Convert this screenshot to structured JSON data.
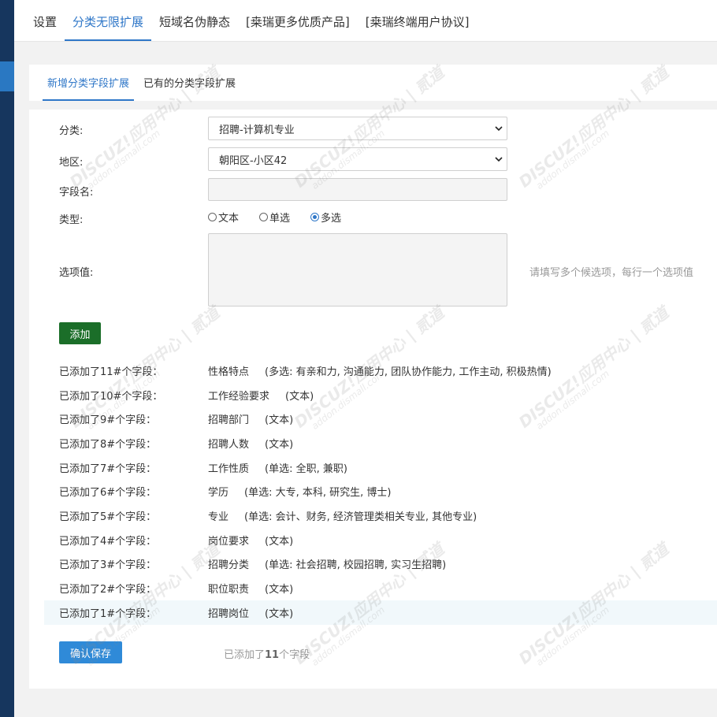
{
  "top_nav": {
    "tabs": [
      {
        "label": "设置"
      },
      {
        "label": "分类无限扩展"
      },
      {
        "label": "短域名伪静态"
      },
      {
        "label": "[桒瑞更多优质产品]"
      },
      {
        "label": "[桒瑞终端用户协议]"
      }
    ],
    "active_index": 1
  },
  "sub_tabs": {
    "tabs": [
      {
        "label": "新增分类字段扩展"
      },
      {
        "label": "已有的分类字段扩展"
      }
    ],
    "active_index": 0
  },
  "form": {
    "category_label": "分类:",
    "category_value": "招聘-计算机专业",
    "region_label": "地区:",
    "region_value": "朝阳区-小区42",
    "field_name_label": "字段名:",
    "field_name_value": "",
    "type_label": "类型:",
    "type_options": [
      "文本",
      "单选",
      "多选"
    ],
    "type_selected": "多选",
    "options_label": "选项值:",
    "options_hint": "请填写多个候选项，每行一个选项值",
    "add_button": "添加"
  },
  "added_fields": [
    {
      "label": "已添加了11#个字段：",
      "name": "性格特点",
      "type": "(多选: 有亲和力, 沟通能力, 团队协作能力, 工作主动, 积极热情)"
    },
    {
      "label": "已添加了10#个字段：",
      "name": "工作经验要求",
      "type": "(文本)"
    },
    {
      "label": "已添加了9#个字段：",
      "name": "招聘部门",
      "type": "(文本)"
    },
    {
      "label": "已添加了8#个字段：",
      "name": "招聘人数",
      "type": "(文本)"
    },
    {
      "label": "已添加了7#个字段：",
      "name": "工作性质",
      "type": "(单选: 全职, 兼职)"
    },
    {
      "label": "已添加了6#个字段：",
      "name": "学历",
      "type": "(单选: 大专, 本科, 研究生, 博士)"
    },
    {
      "label": "已添加了5#个字段：",
      "name": "专业",
      "type": "(单选: 会计、财务, 经济管理类相关专业, 其他专业)"
    },
    {
      "label": "已添加了4#个字段：",
      "name": "岗位要求",
      "type": "(文本)"
    },
    {
      "label": "已添加了3#个字段：",
      "name": "招聘分类",
      "type": "(单选: 社会招聘, 校园招聘, 实习生招聘)"
    },
    {
      "label": "已添加了2#个字段：",
      "name": "职位职责",
      "type": "(文本)"
    },
    {
      "label": "已添加了1#个字段：",
      "name": "招聘岗位",
      "type": "(文本)"
    }
  ],
  "footer": {
    "save_button": "确认保存",
    "count_prefix": "已添加了",
    "count_value": "11",
    "count_suffix": "个字段"
  },
  "watermark": {
    "line1": "DISCUZ!应用中心 | 贰道",
    "line2": "addon.dismall.com"
  },
  "colors": {
    "accent": "#2f77c8",
    "add_button": "#1b6e29",
    "save_button": "#2f8ad8",
    "left_rail": "#16365e"
  }
}
